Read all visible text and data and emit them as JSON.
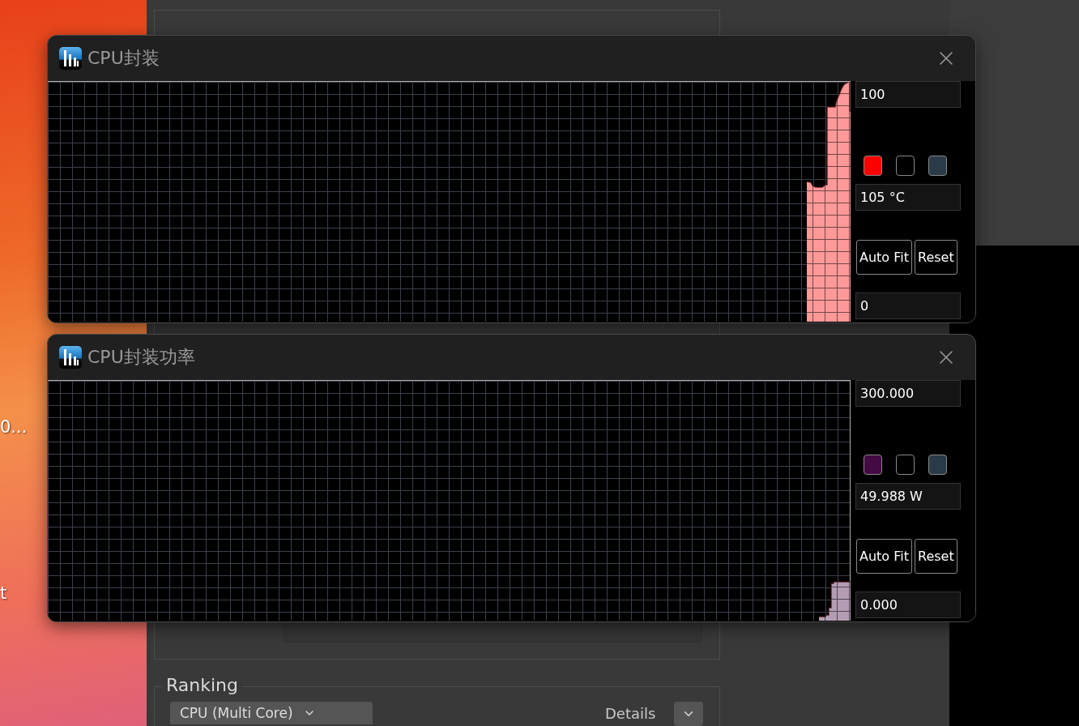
{
  "desktop": {
    "icon_labels": [
      "0...",
      "t"
    ]
  },
  "background_window": {
    "group_title": "Ranking",
    "benchmark_select": "CPU (Multi Core)",
    "details_label": "Details"
  },
  "graph_windows": [
    {
      "title": "CPU封装",
      "max": "100",
      "current": "105 °C",
      "min": "0",
      "swatches": [
        {
          "color": "#ff0000"
        },
        {
          "color": "#000000"
        },
        {
          "color": "#2b3a48"
        }
      ],
      "buttons": [
        "Auto Fit",
        "Reset"
      ]
    },
    {
      "title": "CPU封装功率",
      "max": "300.000",
      "current": "49.988 W",
      "min": "0.000",
      "swatches": [
        {
          "color": "#440a44"
        },
        {
          "color": "#000000"
        },
        {
          "color": "#2b3a48"
        }
      ],
      "buttons": [
        "Auto Fit",
        "Reset"
      ]
    }
  ]
}
